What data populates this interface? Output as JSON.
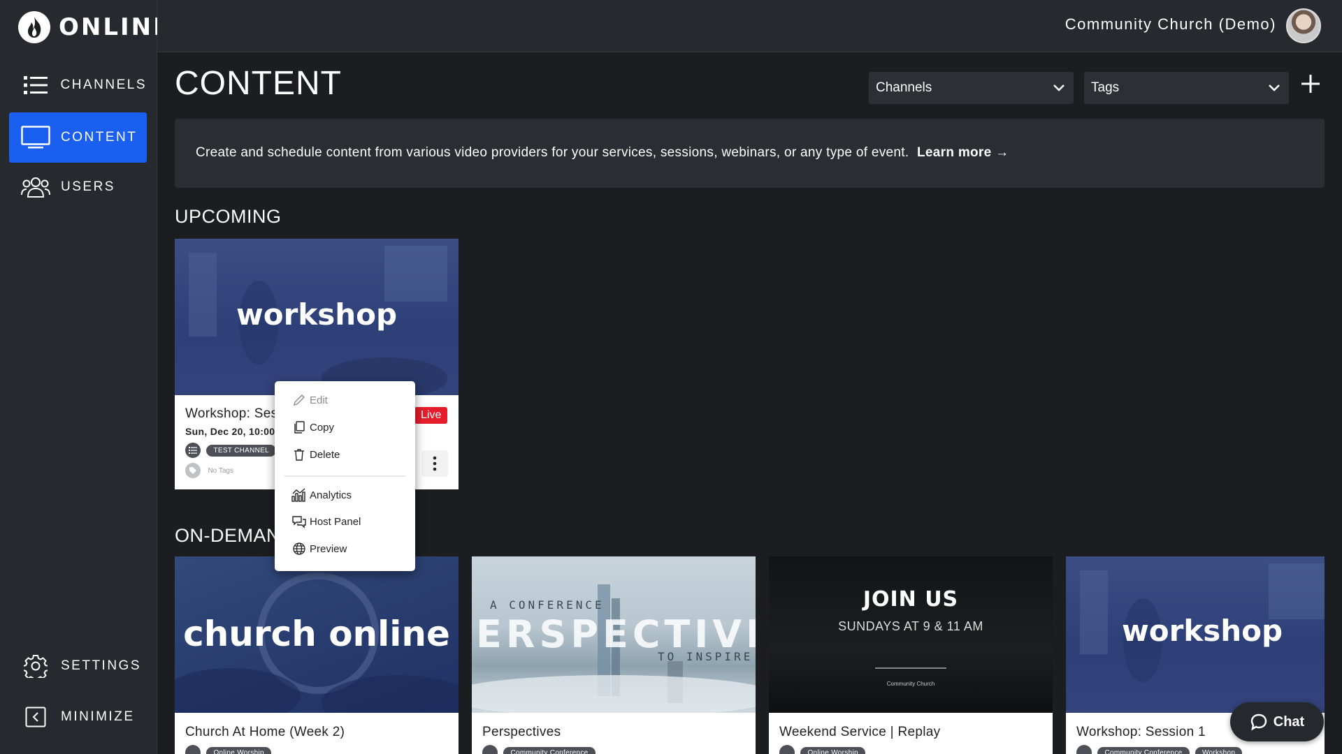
{
  "brand": {
    "logo_text": "ONLINE"
  },
  "sidebar": {
    "items": [
      {
        "label": "CHANNELS",
        "icon": "list-icon"
      },
      {
        "label": "CONTENT",
        "icon": "monitor-icon",
        "active": true
      },
      {
        "label": "USERS",
        "icon": "users-icon"
      }
    ],
    "bottom": [
      {
        "label": "SETTINGS",
        "icon": "gear-icon"
      },
      {
        "label": "MINIMIZE",
        "icon": "collapse-icon"
      }
    ]
  },
  "header": {
    "org_name": "Community Church (Demo)"
  },
  "page": {
    "title": "CONTENT",
    "filters": {
      "channels": "Channels",
      "tags": "Tags"
    },
    "banner_text": "Create and schedule content from various video providers for your services, sessions, webinars, or any type of event.",
    "banner_link": "Learn more →"
  },
  "upcoming": {
    "heading": "UPCOMING",
    "card": {
      "thumb_text": "workshop",
      "title": "Workshop: Ses",
      "date": "Sun, Dec 20, 10:00",
      "channel": "TEST CHANNEL",
      "tags": "No Tags",
      "live": "Live"
    }
  },
  "context_menu": {
    "items": [
      "Edit",
      "Copy",
      "Delete",
      "Analytics",
      "Host Panel",
      "Preview"
    ]
  },
  "ondemand": {
    "heading": "ON-DEMAN",
    "cards": [
      {
        "thumb_text": "church online",
        "title": "Church At Home (Week 2)",
        "pills": [
          "Online Worship"
        ]
      },
      {
        "thumb_line1": "A CONFERENCE",
        "thumb_big": "ERSPECTIVE",
        "thumb_line2": "TO INSPIRE",
        "title": "Perspectives",
        "pills": [
          "Community Conference"
        ]
      },
      {
        "thumb_big": "JOIN US",
        "thumb_line1": "SUNDAYS AT 9 & 11 AM",
        "thumb_logo": "Community Church",
        "title": "Weekend Service | Replay",
        "pills": [
          "Online Worship"
        ]
      },
      {
        "thumb_text": "workshop",
        "title": "Workshop: Session 1",
        "pills": [
          "Community Conference",
          "Workshop"
        ]
      }
    ]
  },
  "chat": {
    "label": "Chat"
  }
}
